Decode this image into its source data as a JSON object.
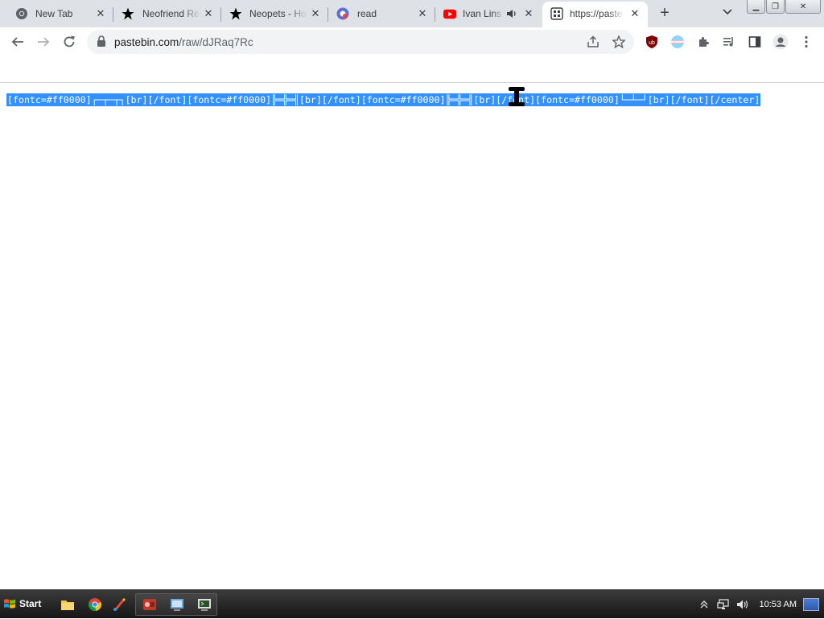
{
  "browser": {
    "tabs": [
      {
        "title": "New Tab",
        "icon": "chrome-icon"
      },
      {
        "title": "Neofriend Re",
        "icon": "star-icon"
      },
      {
        "title": "Neopets - Ho",
        "icon": "star-icon"
      },
      {
        "title": "read",
        "icon": "gmail-icon"
      },
      {
        "title": "Ivan Lins",
        "icon": "youtube-icon",
        "audio": "speaker-icon"
      },
      {
        "title": "https://paste",
        "icon": "pastebin-icon",
        "active": true
      }
    ],
    "close_glyph": "✕",
    "new_tab_glyph": "+",
    "tab_search_glyph": "⌄",
    "window_buttons": {
      "minimize": "▁",
      "maximize": "❐",
      "close": "✕"
    },
    "nav": {
      "back": "←",
      "forward": "→",
      "reload": "↻"
    },
    "address": {
      "host": "pastebin.com",
      "path": "/raw/dJRaq7Rc"
    },
    "accent": "#3390ff"
  },
  "page": {
    "text": "[fontc=#ff0000]┌─┬─┬┐[br][/font][fontc=#ff0000]╠═╬═╣[br][/font][fontc=#ff0000]╠═╬═╣[br][/font][fontc=#ff0000]└─┴─┘[br][/font][/center]"
  },
  "taskbar": {
    "start_label": "Start",
    "clock": "10:53 AM"
  }
}
